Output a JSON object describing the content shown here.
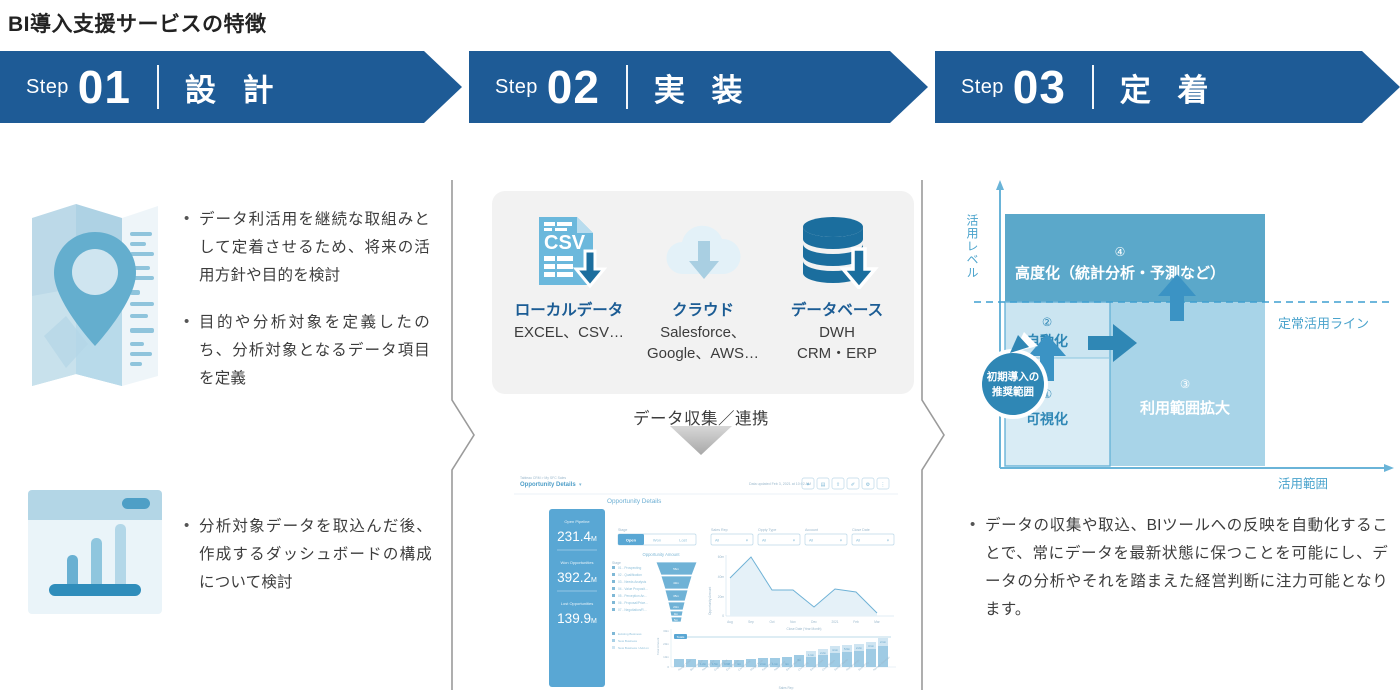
{
  "page": {
    "title": "BI導入支援サービスの特徴"
  },
  "steps": [
    {
      "word": "Step",
      "number": "01",
      "name": "設 計"
    },
    {
      "word": "Step",
      "number": "02",
      "name": "実 装"
    },
    {
      "word": "Step",
      "number": "03",
      "name": "定 着"
    }
  ],
  "column1": {
    "icons": [
      {
        "name": "map-pin-icon"
      },
      {
        "name": "dashboard-chart-icon"
      }
    ],
    "bullets_top": [
      "データ利活用を継続な取組みとして定着させるため、将来の活用方針や目的を検討",
      "目的や分析対象を定義したのち、分析対象となるデータ項目を定義"
    ],
    "bullets_bottom": [
      "分析対象データを取込んだ後、作成するダッシュボードの構成について検討"
    ]
  },
  "column2": {
    "sources": [
      {
        "icon": "csv-file-download-icon",
        "title": "ローカルデータ",
        "sub": "EXCEL、CSV…"
      },
      {
        "icon": "cloud-download-icon",
        "title": "クラウド",
        "sub": "Salesforce、\nGoogle、AWS…"
      },
      {
        "icon": "database-download-icon",
        "title": "データベース",
        "sub": "DWH\nCRM・ERP"
      }
    ],
    "flow_label": "データ収集／連携",
    "dashboard": {
      "breadcrumb": "Tableau CRM > My SFC Sales",
      "name": "Opportunity Details",
      "updated": "Data updated Feb 3, 2021 at 10:02 AM",
      "heading": "Opportunity Details",
      "kpis": [
        {
          "label": "Open Pipeline",
          "value": "231.4",
          "unit": "M"
        },
        {
          "label": "Won Opportunities",
          "value": "392.2",
          "unit": "M"
        },
        {
          "label": "Lost Opportunities",
          "value": "139.9",
          "unit": "M"
        }
      ],
      "filters": [
        {
          "label": "Stage",
          "type": "toggle",
          "options": [
            "Open",
            "Won",
            "Lost"
          ],
          "selected": "Open"
        },
        {
          "label": "Sales Rep",
          "type": "select",
          "value": "All"
        },
        {
          "label": "Oppty Type",
          "type": "select",
          "value": "All"
        },
        {
          "label": "Account",
          "type": "select",
          "value": "All"
        },
        {
          "label": "Close Date",
          "type": "select",
          "value": "All"
        }
      ],
      "funnel": {
        "title": "Opportunity Amount",
        "legend_title": "Stage",
        "legend": [
          "01 - Prospecting",
          "02 - Qualification",
          "03 - Needs Analysis",
          "04 - Value Proposit…",
          "05 - Perception An…",
          "06 - Proposal/Price…",
          "07 - Negotiation/R…"
        ],
        "values": [
          7,
          6,
          5,
          3,
          2,
          1.2
        ]
      },
      "line_chart": {
        "ylabel": "Opportunity Amount",
        "xlabel": "Close Date (Year Month)",
        "x": [
          "Aug",
          "Sep",
          "Oct",
          "Nov",
          "Dec",
          "2021",
          "Feb",
          "Mar"
        ],
        "y": [
          38,
          56,
          30,
          30,
          16,
          31,
          29,
          5
        ],
        "ylim": [
          0,
          60
        ],
        "yticks": [
          "60m",
          "40m",
          "20m",
          "0"
        ]
      },
      "bar_chart": {
        "ylabel": "Total Amount",
        "xlabel": "Sales Rep",
        "yticks": [
          "30m",
          "20m",
          "10m",
          "0"
        ],
        "legend": [
          "Existing Business",
          "New Business",
          "New Business / Add on"
        ],
        "bar_labels": [
          "",
          "",
          "1.2m",
          "1.5m",
          "0.9M",
          "1m",
          "",
          "2.1m",
          "1.1m",
          "1m",
          "3m",
          "1.1m",
          "2.2m",
          "4.1m",
          "5.9m",
          "2.2m",
          "3.1m",
          "2.1m"
        ]
      }
    }
  },
  "column3": {
    "quadrant": {
      "ylabel": "活用レベル",
      "xlabel": "活用範囲",
      "baseline_label": "定常活用ライン",
      "callout": "初期導入の\n推奨範囲",
      "cells": [
        {
          "num": "①",
          "label": "可視化"
        },
        {
          "num": "②",
          "label": "自動化"
        },
        {
          "num": "③",
          "label": "利用範囲拡大"
        },
        {
          "num": "④",
          "label": "高度化（統計分析・予測など）"
        }
      ]
    },
    "bullets": [
      "データの収集や取込、BIツールへの反映を自動化することで、常にデータを最新状態に保つことを可能にし、データの分析やそれを踏まえた経営判断に注力可能となります。"
    ]
  },
  "colors": {
    "banner_blue": "#1e5b96",
    "accent_blue": "#2b7fb0",
    "light_blue": "#b9d9e8",
    "pale_blue": "#d8eaf3",
    "mid_blue": "#5ba8ca",
    "text_gray": "#3c3c3c"
  }
}
